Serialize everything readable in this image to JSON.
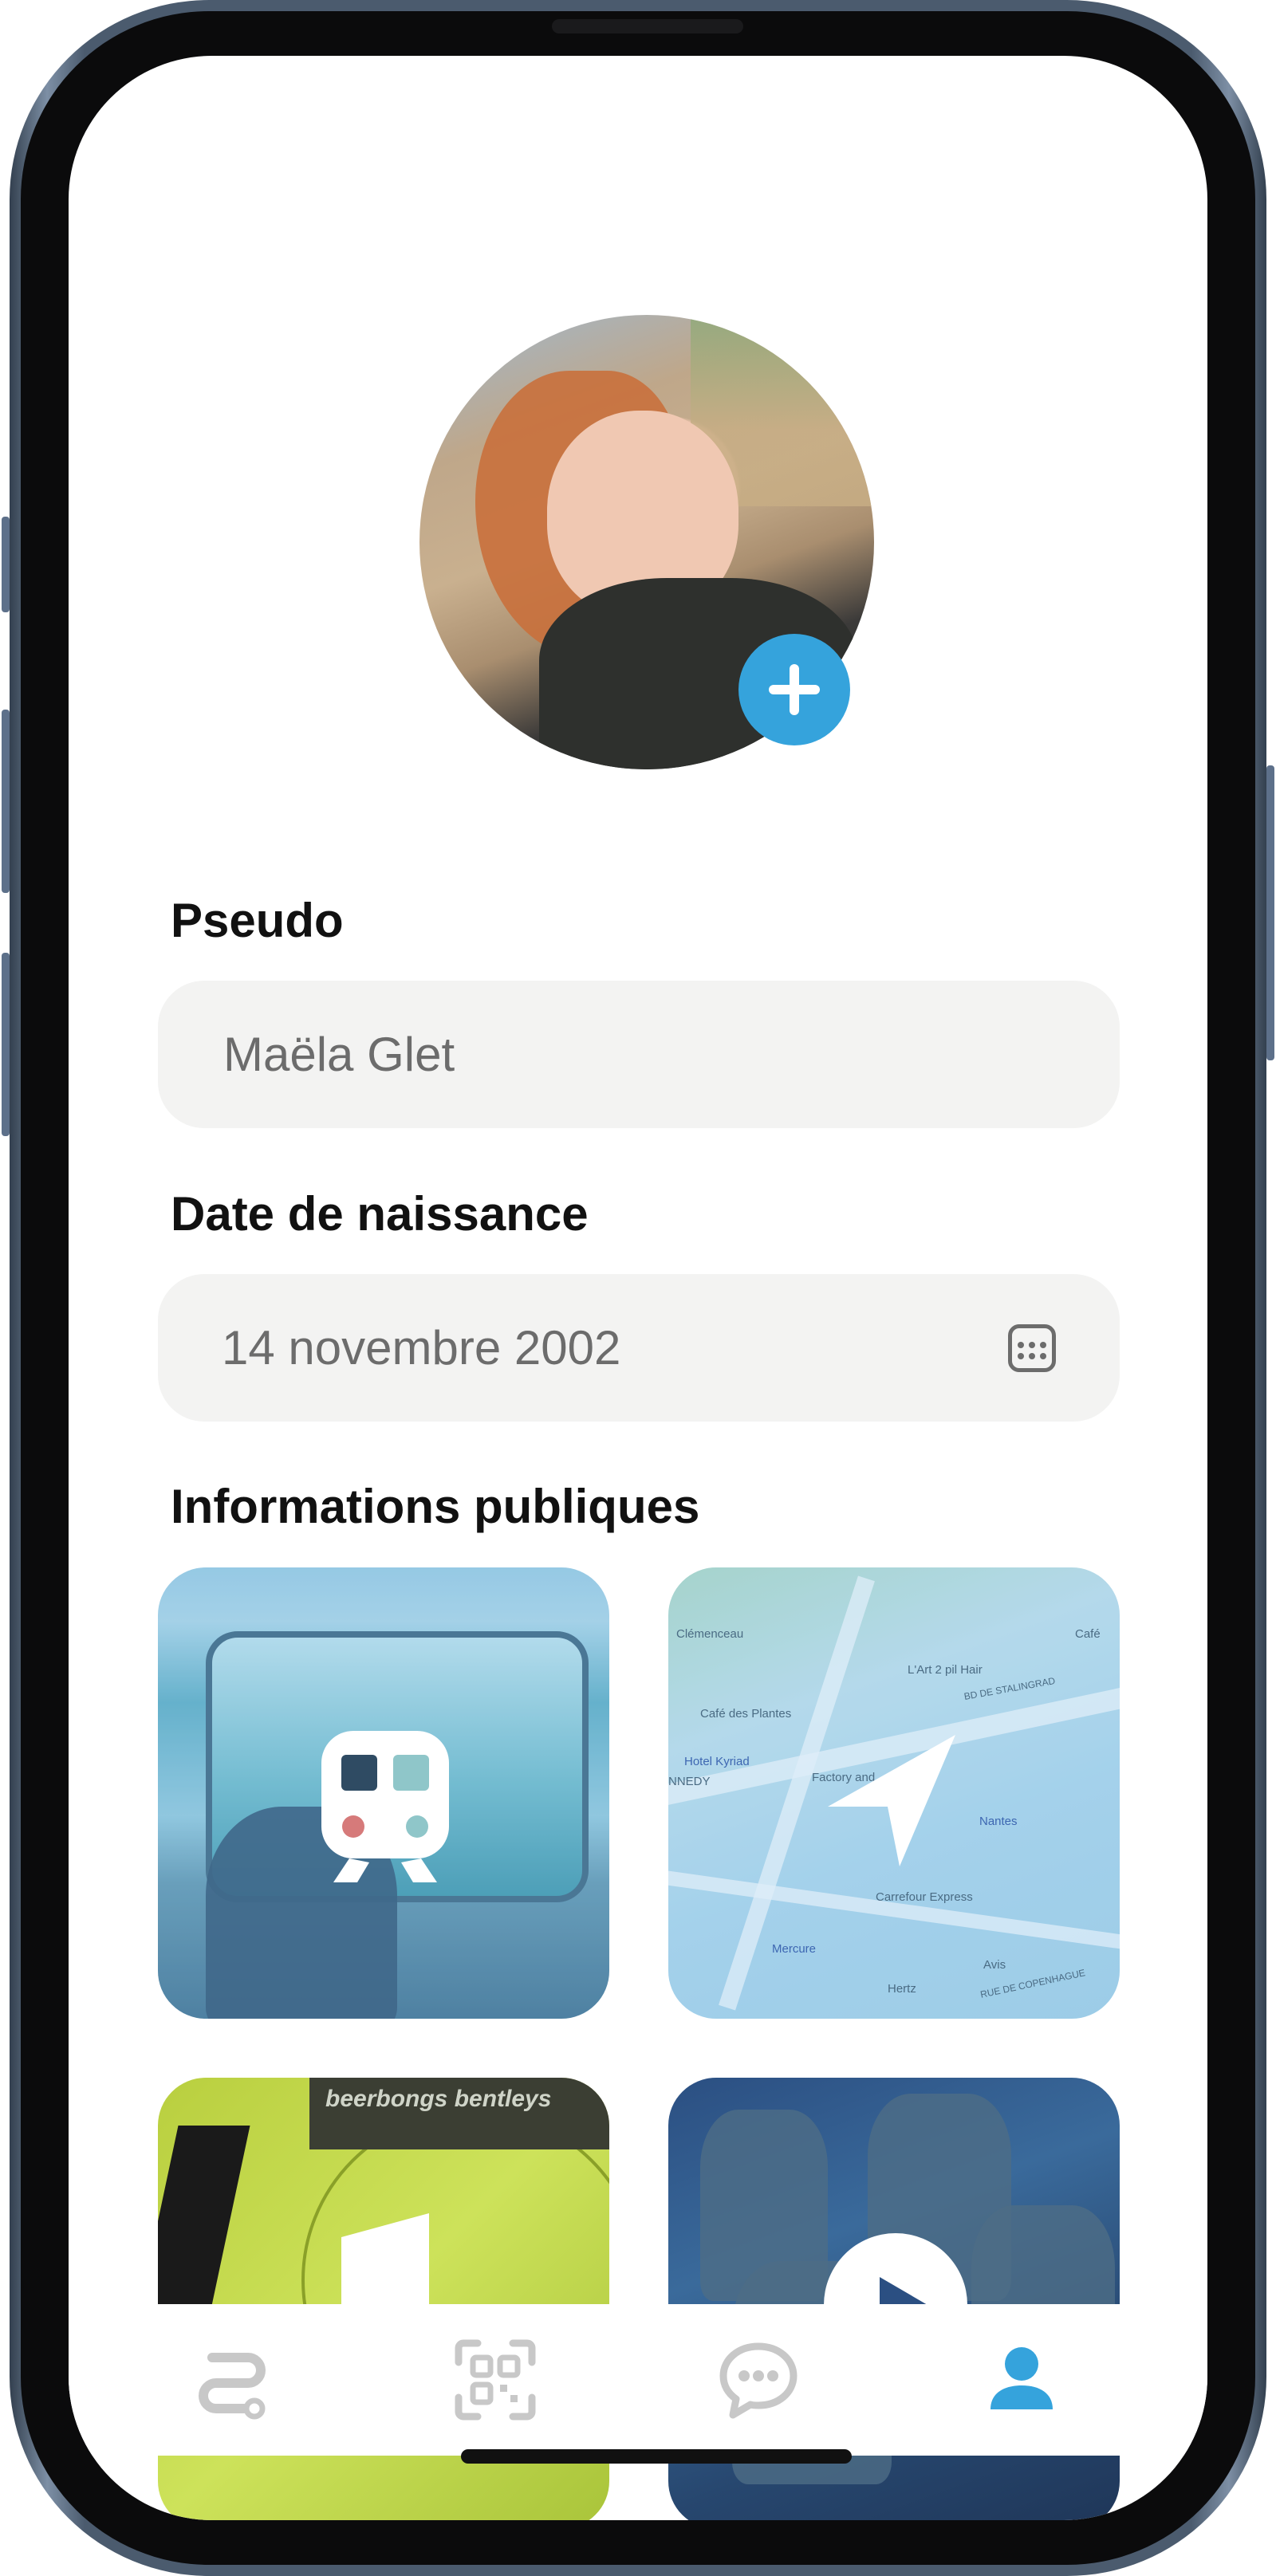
{
  "profile": {
    "avatar_alt": "Photo de profil",
    "add_photo_icon": "plus-icon"
  },
  "form": {
    "pseudo_label": "Pseudo",
    "pseudo_value": "Maëla Glet",
    "birthdate_label": "Date de naissance",
    "birthdate_value": "14 novembre 2002",
    "calendar_icon": "calendar-icon"
  },
  "public_info": {
    "title": "Informations publiques",
    "cards": [
      {
        "name": "train",
        "icon": "train-icon"
      },
      {
        "name": "location",
        "icon": "location-arrow-icon",
        "map_labels": [
          "Clémenceau",
          "L'Art 2 pil Hair",
          "BD DE STALINGRAD",
          "Café des Plantes",
          "Hotel Kyriad",
          "Factory and",
          "NNEDY",
          "Nantes",
          "Carrefour Express",
          "Mercure",
          "Avis",
          "Hertz",
          "RUE DE COPENHAGUE",
          "Café"
        ]
      },
      {
        "name": "music",
        "icon": "music-note-icon",
        "album_text": "beerbongs bentleys"
      },
      {
        "name": "anime",
        "icon": "play-icon"
      }
    ]
  },
  "nav": {
    "items": [
      {
        "name": "routes",
        "icon": "route-icon",
        "active": false
      },
      {
        "name": "qr-code",
        "icon": "qr-code-icon",
        "active": false
      },
      {
        "name": "messages",
        "icon": "chat-bubble-icon",
        "active": false
      },
      {
        "name": "profile",
        "icon": "user-icon",
        "active": true
      }
    ]
  },
  "colors": {
    "accent": "#35a3dc",
    "field_bg": "#f3f3f2",
    "placeholder_text": "#6c6c6c",
    "inactive_icon": "#c8c8c8"
  }
}
